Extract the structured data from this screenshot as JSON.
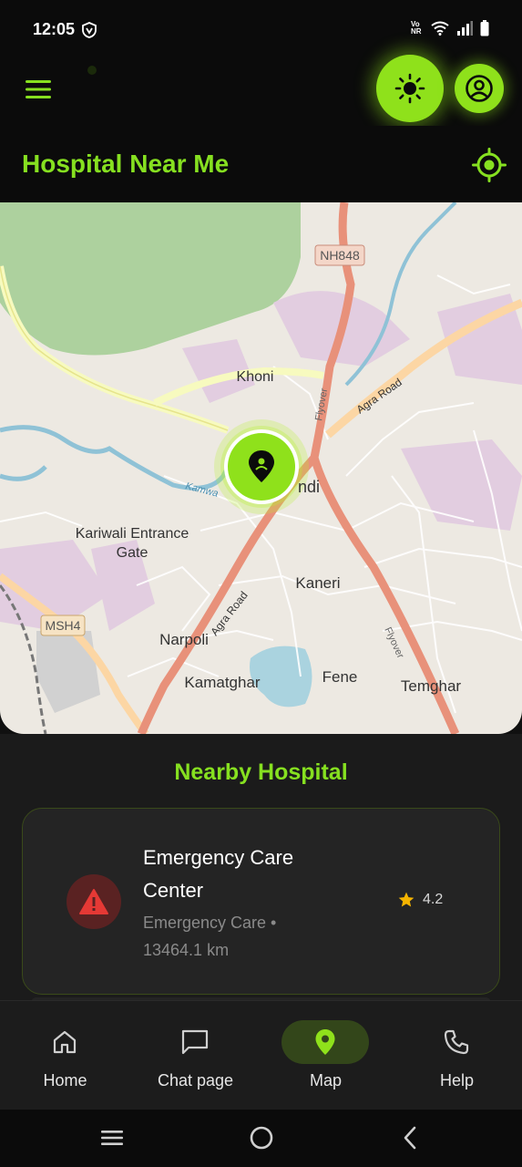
{
  "status_bar": {
    "time": "12:05",
    "volte_top": "Vo",
    "volte_bottom": "NR",
    "icons": [
      "vpn-shield-icon",
      "wifi-icon",
      "signal-icon",
      "battery-icon"
    ]
  },
  "header": {
    "menu_icon": "hamburger-menu-icon",
    "theme_icon": "sun-icon",
    "profile_icon": "user-circle-icon"
  },
  "page": {
    "title": "Hospital Near Me",
    "locate_icon": "gps-target-icon"
  },
  "map": {
    "labels": {
      "nh848": "NH848",
      "msh4": "MSH4",
      "khoni": "Khoni",
      "agra_road_ne": "Agra Road",
      "agra_road_sw": "Agra Road",
      "flyover_n": "Flyover",
      "flyover_s": "Flyover",
      "kamwari": "Kamwa",
      "bhiwandi_partial": "ndi",
      "kariwali_1": "Kariwali Entrance",
      "kariwali_2": "Gate",
      "kaneri": "Kaneri",
      "narpoli": "Narpoli",
      "kamatghar": "Kamatghar",
      "fene": "Fene",
      "temghar": "Temghar"
    },
    "marker_icon": "location-pin-icon"
  },
  "nearby": {
    "section_title": "Nearby Hospital",
    "items": [
      {
        "name_line1": "Emergency Care",
        "name_line2": "Center",
        "type_line": "Emergency Care •",
        "distance": "13464.1 km",
        "rating": "4.2",
        "icon": "warning-triangle-icon",
        "star_icon": "star-icon"
      }
    ]
  },
  "bottom_nav": {
    "items": [
      {
        "label": "Home",
        "icon": "home-icon"
      },
      {
        "label": "Chat page",
        "icon": "chat-bubble-icon"
      },
      {
        "label": "Map",
        "icon": "map-pin-icon"
      },
      {
        "label": "Help",
        "icon": "phone-icon"
      }
    ],
    "active": "Map"
  },
  "system_nav": {
    "icons": [
      "recents-icon",
      "home-circle-icon",
      "back-icon"
    ]
  },
  "colors": {
    "accent": "#8fe11b",
    "title_green": "#86e020",
    "background": "#0b0b0b",
    "sheet": "#1b1b1b",
    "card": "#242424",
    "danger": "#e53935",
    "star": "#f5b400"
  }
}
